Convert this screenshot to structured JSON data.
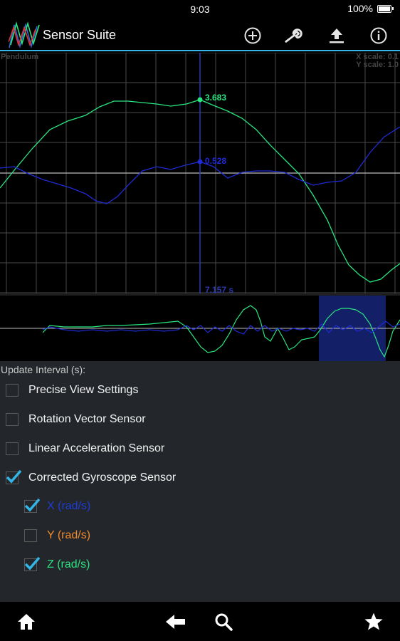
{
  "status": {
    "time": "9:03",
    "battery": "100%"
  },
  "app": {
    "title": "Sensor Suite"
  },
  "toolbar": {
    "icons": [
      "add-circle-icon",
      "wrench-icon",
      "upload-icon",
      "info-icon"
    ]
  },
  "graph": {
    "label": "Pendulum",
    "x_scale": "X scale: 0.1",
    "y_scale": "Y scale: 1.0",
    "cursor_green_value": "3.683",
    "cursor_blue_value": "0.528",
    "cursor_time": "7.157 s",
    "colors": {
      "green": "#29e67f",
      "blue": "#1f2bd6",
      "grid": "#5a5a5a",
      "cursor": "#2a3aa8"
    }
  },
  "settings": {
    "interval_label": "Update Interval (s):",
    "items": [
      {
        "label": "Precise View Settings",
        "checked": false,
        "color": "#f2f2f2"
      },
      {
        "label": "Rotation Vector Sensor",
        "checked": false,
        "color": "#f2f2f2"
      },
      {
        "label": "Linear Acceleration Sensor",
        "checked": false,
        "color": "#f2f2f2"
      },
      {
        "label": "Corrected Gyroscope Sensor",
        "checked": true,
        "color": "#f2f2f2"
      }
    ],
    "axes": [
      {
        "label": "X (rad/s)",
        "checked": true,
        "color": "#1f3bd6"
      },
      {
        "label": "Y (rad/s)",
        "checked": false,
        "color": "#f0892a"
      },
      {
        "label": "Z (rad/s)",
        "checked": true,
        "color": "#2de07f"
      }
    ]
  },
  "nav": {
    "icons": [
      "home-icon",
      "back-arrow-icon",
      "search-icon",
      "star-icon"
    ]
  }
}
